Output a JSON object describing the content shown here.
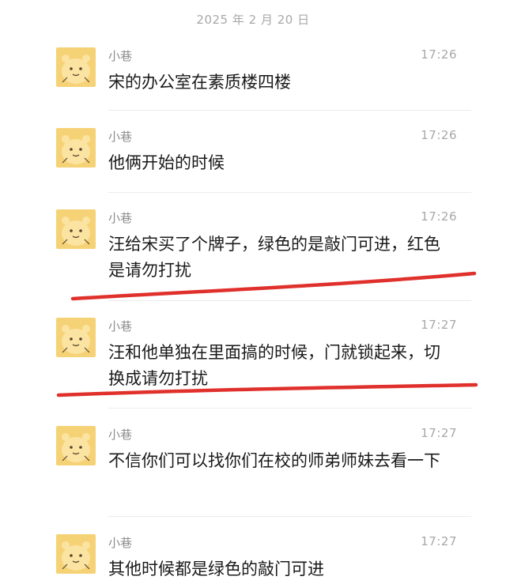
{
  "chat": {
    "date_separator": "2025 年 2 月 20 日",
    "messages": [
      {
        "sender": "小巷",
        "time": "17:26",
        "text": "宋的办公室在素质楼四楼"
      },
      {
        "sender": "小巷",
        "time": "17:26",
        "text": "他俩开始的时候"
      },
      {
        "sender": "小巷",
        "time": "17:26",
        "text": "汪给宋买了个牌子，绿色的是敲门可进，红色是请勿打扰"
      },
      {
        "sender": "小巷",
        "time": "17:27",
        "text": "汪和他单独在里面搞的时候，门就锁起来，切换成请勿打扰"
      },
      {
        "sender": "小巷",
        "time": "17:27",
        "text": "不信你们可以找你们在校的师弟师妹去看一下"
      },
      {
        "sender": "小巷",
        "time": "17:27",
        "text": "其他时候都是绿色的敲门可进"
      }
    ]
  },
  "colors": {
    "annotation_red": "#e0302c",
    "avatar_bg": "#f6d277"
  },
  "icons": {
    "avatar": "cartoon-bear-avatar-icon"
  }
}
